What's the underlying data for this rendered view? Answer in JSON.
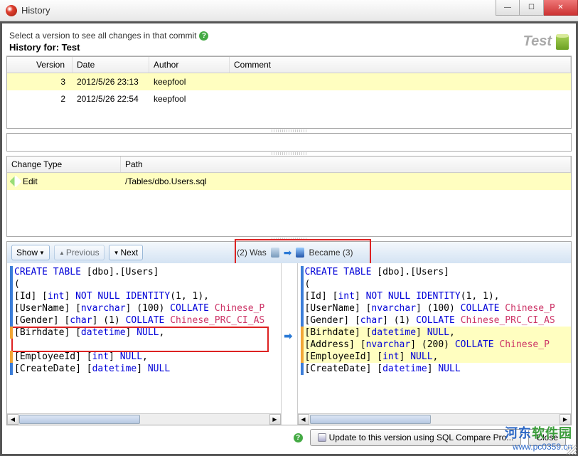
{
  "window": {
    "title": "History"
  },
  "header": {
    "help_text": "Select a version to see all changes in that commit",
    "history_for_prefix": "History for: ",
    "history_for_name": "Test",
    "db_label": "Test"
  },
  "history_table": {
    "columns": {
      "version": "Version",
      "date": "Date",
      "author": "Author",
      "comment": "Comment"
    },
    "rows": [
      {
        "version": "3",
        "date": "2012/5/26 23:13",
        "author": "keepfool",
        "comment": "",
        "selected": true
      },
      {
        "version": "2",
        "date": "2012/5/26 22:54",
        "author": "keepfool",
        "comment": "",
        "selected": false
      }
    ]
  },
  "changes_table": {
    "columns": {
      "change_type": "Change Type",
      "path": "Path"
    },
    "rows": [
      {
        "change_type": "Edit",
        "path": "/Tables/dbo.Users.sql"
      }
    ]
  },
  "diff_toolbar": {
    "show": "Show",
    "previous": "Previous",
    "next": "Next",
    "was_prefix": "(2) Was",
    "became_suffix": "Became (3)"
  },
  "diff_left": {
    "lines": [
      {
        "txt": "CREATE TABLE [dbo].[Users]",
        "bar": "blue"
      },
      {
        "txt": "(",
        "bar": "blue"
      },
      {
        "txt": "[Id] [int] NOT NULL IDENTITY(1, 1),",
        "bar": "blue"
      },
      {
        "txt": "[UserName] [nvarchar] (100) COLLATE Chinese_P",
        "bar": "blue"
      },
      {
        "txt": "[Gender] [char] (1) COLLATE Chinese_PRC_CI_AS",
        "bar": "blue"
      },
      {
        "txt": "[Birhdate] [datetime] NULL,",
        "bar": "orange"
      },
      {
        "txt": "",
        "bar": ""
      },
      {
        "txt": "[EmployeeId] [int] NULL,",
        "bar": "orange"
      },
      {
        "txt": "[CreateDate] [datetime] NULL",
        "bar": "blue"
      }
    ]
  },
  "diff_right": {
    "lines": [
      {
        "txt": "CREATE TABLE [dbo].[Users]",
        "bar": "blue"
      },
      {
        "txt": "(",
        "bar": "blue"
      },
      {
        "txt": "[Id] [int] NOT NULL IDENTITY(1, 1),",
        "bar": "blue"
      },
      {
        "txt": "[UserName] [nvarchar] (100) COLLATE Chinese_P",
        "bar": "blue"
      },
      {
        "txt": "[Gender] [char] (1) COLLATE Chinese_PRC_CI_AS",
        "bar": "blue"
      },
      {
        "txt": "[Birhdate] [datetime] NULL,",
        "bar": "orange",
        "hl": true
      },
      {
        "txt": "[Address] [nvarchar] (200) COLLATE Chinese_P",
        "bar": "orange",
        "hl": true
      },
      {
        "txt": "[EmployeeId] [int] NULL,",
        "bar": "orange",
        "hl": true
      },
      {
        "txt": "[CreateDate] [datetime] NULL",
        "bar": "blue"
      }
    ]
  },
  "footer": {
    "update_btn": "Update to this version using SQL Compare Pro...",
    "close_btn": "Close"
  },
  "watermark": {
    "cn_part1": "河东",
    "cn_part2": "软件园",
    "url": "www.pc0359.cn"
  }
}
